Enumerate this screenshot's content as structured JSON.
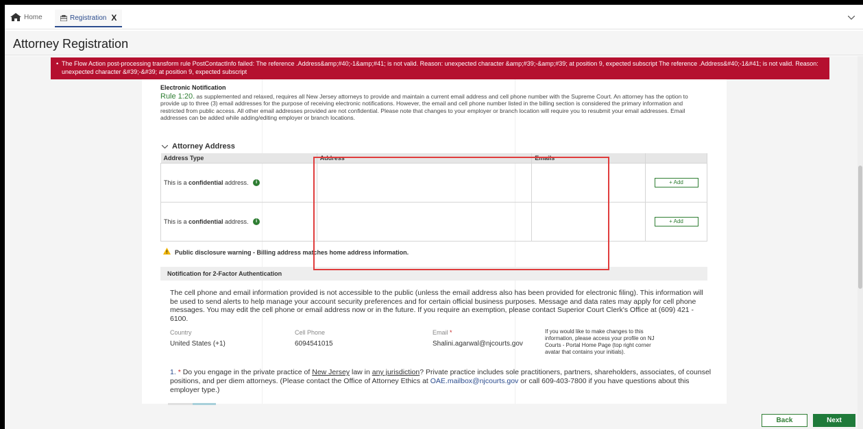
{
  "tabs": {
    "home_label": "Home",
    "registration_label": "Registration",
    "close_glyph": "X"
  },
  "page": {
    "title": "Attorney Registration"
  },
  "error_message": "The Flow Action post-processing transform rule PostContactInfo failed: The reference .Address&amp;#40;-1&amp;#41; is not valid. Reason: unexpected character &amp;#39;-&amp;#39; at position 9, expected subscript The reference .Address&#40;-1&#41; is not valid. Reason: unexpected character &#39;-&#39; at position 9, expected subscript",
  "electronic_notification": {
    "heading": "Electronic Notification",
    "rule_link": "Rule 1:20.",
    "rule_text": " as supplemented and relaxed, requires all New Jersey attorneys to provide and maintain a current email address and cell phone number with the Supreme Court. An attorney has the option to provide up to three (3) email addresses for the purpose of receiving electronic notifications. However, the email and cell phone number listed in the billing section is considered the primary information and restricted from public access. All other email addresses provided are not confidential. Please note that changes to your employer or branch location will require you to resubmit your email addresses. Email addresses can be added while adding/editing employer or branch locations."
  },
  "attorney_address": {
    "section_title": "Attorney Address",
    "columns": {
      "type": "Address Type",
      "address": "Address",
      "emails": "Emails"
    },
    "rows": [
      {
        "prefix": "This is a ",
        "bold": "confidential",
        "suffix": " address.",
        "address": "",
        "emails": "",
        "add_label": "+ Add"
      },
      {
        "prefix": "This is a ",
        "bold": "confidential",
        "suffix": " address.",
        "address": "",
        "emails": "",
        "add_label": "+ Add"
      }
    ],
    "info_glyph": "i"
  },
  "warning": {
    "text": "Public disclosure warning - Billing address matches home address information."
  },
  "two_factor": {
    "heading": "Notification for 2-Factor Authentication",
    "paragraph": "The cell phone and email information provided is not accessible to the public (unless the email address also has been provided for electronic filing). This information will be used to send alerts to help manage your account security preferences and for certain official business purposes. Message and data rates may apply for cell phone messages. You may edit the cell phone or email address now or in the future. If you require an exemption, please contact Superior Court Clerk's Office at (609) 421 - 6100.",
    "country_label": "Country",
    "country_value": "United States (+1)",
    "cell_label": "Cell Phone",
    "cell_value": "6094541015",
    "email_label": "Email",
    "email_required": "*",
    "email_value": "Shalini.agarwal@njcourts.gov",
    "profile_note": "If you would like to make changes to this information, please access your profile on NJ Courts - Portal Home Page (top right corner avatar that contains your initials)."
  },
  "question1": {
    "number": "1.",
    "required": "*",
    "t1": " Do you engage in the private practice of ",
    "u1": "New Jersey",
    "t2": " law in ",
    "u2": "any jurisdiction",
    "t3": "? Private practice includes sole practitioners, partners, shareholders, associates, of counsel positions, and per diem attorneys. (Please contact the Office of Attorney Ethics at ",
    "email": "OAE.mailbox@njcourts.gov",
    "t4": " or call 609-403-7800 if you have questions about this employer type.)"
  },
  "footer": {
    "back_label": "Back",
    "next_label": "Next"
  },
  "colors": {
    "accent_green": "#1f7a3a",
    "error_red": "#b5102f",
    "link_blue": "#2a4b8d",
    "highlight_red": "#e03c3c"
  }
}
